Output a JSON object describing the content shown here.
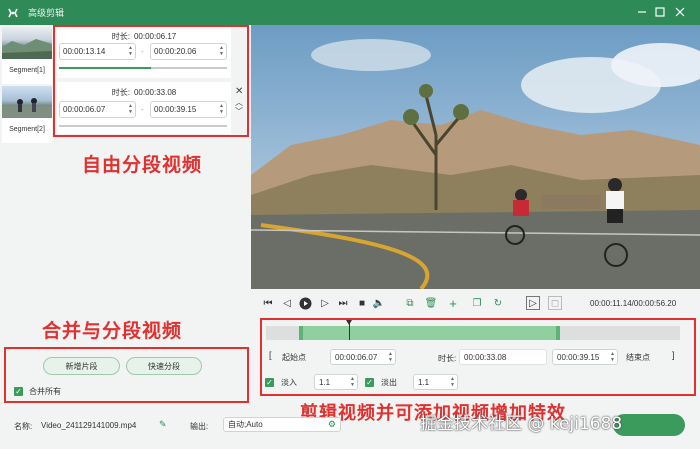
{
  "app": {
    "title": "高级剪辑"
  },
  "segments": [
    {
      "label": "Segment[1]",
      "duration_label": "时长:",
      "duration": "00:00:06.17",
      "start": "00:00:13.14",
      "end": "00:00:20.06",
      "progress": 0.55
    },
    {
      "label": "Segment[2]",
      "duration_label": "时长:",
      "duration": "00:00:33.08",
      "start": "00:00:06.07",
      "end": "00:00:39.15",
      "progress": 0.0
    }
  ],
  "segment_sep": "-",
  "annotations": {
    "segments": "自由分段视频",
    "merge": "合并与分段视频",
    "trim": "剪辑视频并可添加视频增加特效"
  },
  "actions": {
    "new_segment": "新增片段",
    "quick_split": "快速分段",
    "merge_all": "合并所有"
  },
  "player": {
    "time": "00:00:11.14/00:00:56.20"
  },
  "trim": {
    "start_label": "起始点",
    "start": "00:00:06.07",
    "duration_label": "时长:",
    "duration": "00:00:33.08",
    "end": "00:00:39.15",
    "end_label": "结束点",
    "bracket_left": "[",
    "bracket_right": "]",
    "fade_in_label": "淡入",
    "fade_in": "1.1",
    "fade_out_label": "淡出",
    "fade_out": "1.1",
    "range_start": 0.08,
    "range_end": 0.71,
    "playhead": 0.2
  },
  "footer": {
    "name_label": "名称:",
    "name_value": "Video_241129141009.mp4",
    "output_label": "输出:",
    "output_value": "自动;Auto",
    "watermark": "掘金技术社区 @ keji1688"
  },
  "colors": {
    "accent": "#2e8b57",
    "annotation": "#e0302f"
  }
}
